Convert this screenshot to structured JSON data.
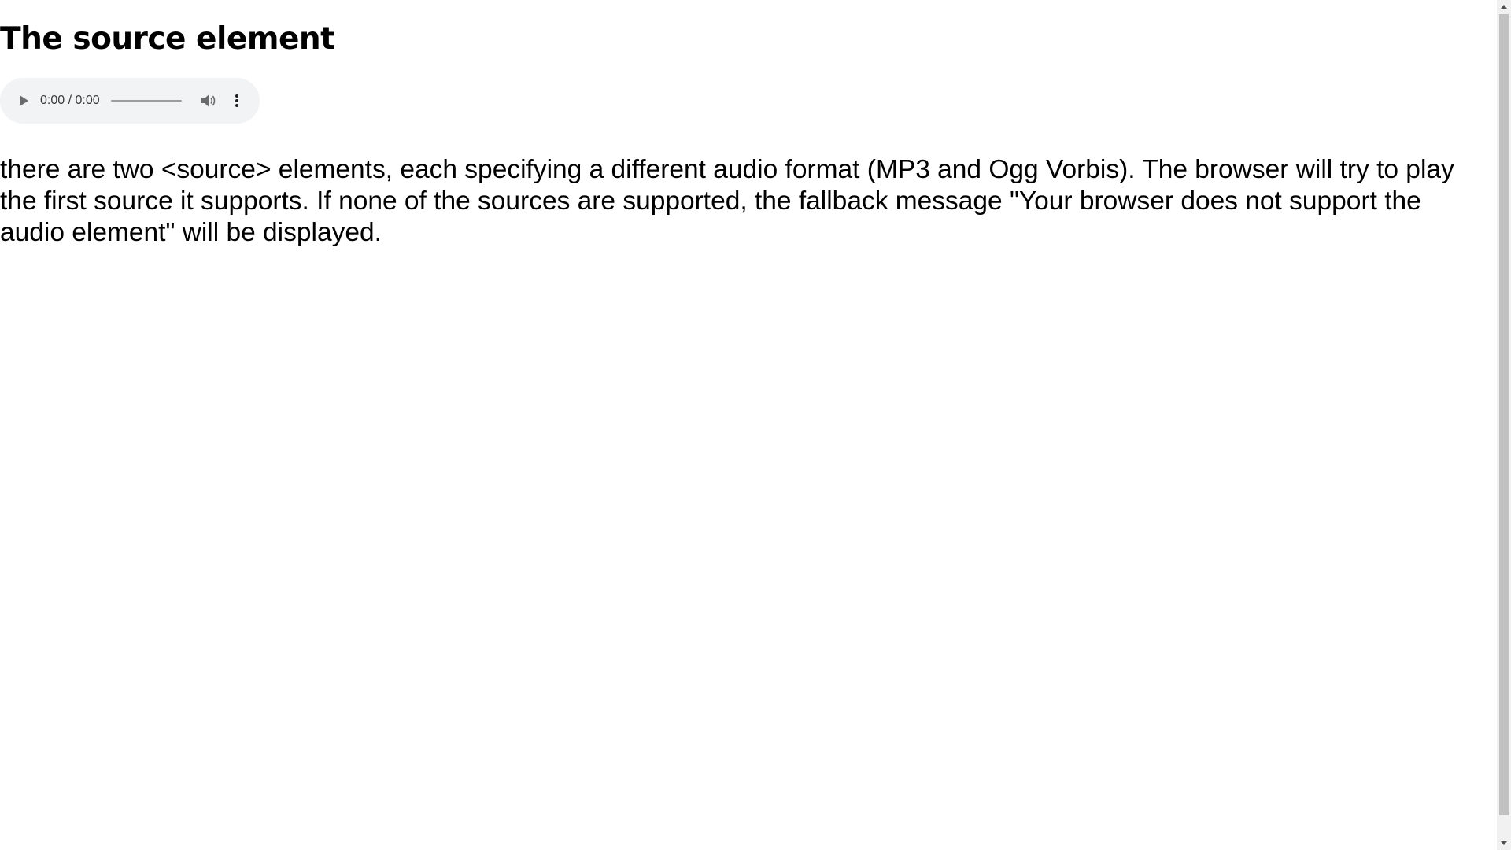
{
  "page": {
    "heading": "The source element",
    "description": "there are two <source> elements, each specifying a different audio format (MP3 and Ogg Vorbis). The browser will try to play the first source it supports. If none of the sources are supported, the fallback message \"Your browser does not support the audio element\" will be displayed."
  },
  "audio_player": {
    "time": "0:00 / 0:00",
    "progress": 0,
    "play_icon": "play-icon",
    "volume_icon": "volume-icon",
    "more_icon": "more-vertical-icon",
    "background_color": "#f1f3f4"
  },
  "scrollbar": {
    "up_icon": "chevron-up-icon",
    "down_icon": "chevron-down-icon"
  }
}
